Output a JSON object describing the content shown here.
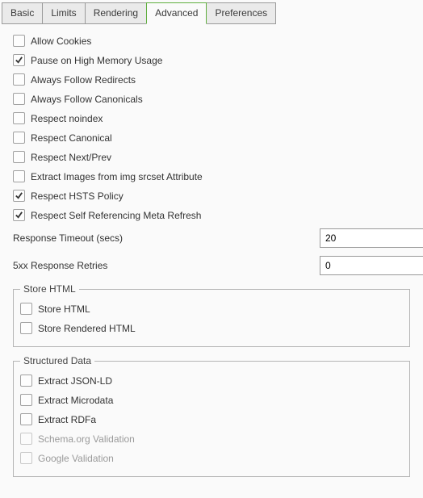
{
  "tabs": [
    {
      "label": "Basic"
    },
    {
      "label": "Limits"
    },
    {
      "label": "Rendering"
    },
    {
      "label": "Advanced"
    },
    {
      "label": "Preferences"
    }
  ],
  "active_tab": "Advanced",
  "checkboxes": [
    {
      "label": "Allow Cookies",
      "checked": false
    },
    {
      "label": "Pause on High Memory Usage",
      "checked": true
    },
    {
      "label": "Always Follow Redirects",
      "checked": false
    },
    {
      "label": "Always Follow Canonicals",
      "checked": false
    },
    {
      "label": "Respect noindex",
      "checked": false
    },
    {
      "label": "Respect Canonical",
      "checked": false
    },
    {
      "label": "Respect Next/Prev",
      "checked": false
    },
    {
      "label": "Extract Images from img srcset Attribute",
      "checked": false
    },
    {
      "label": "Respect HSTS Policy",
      "checked": true
    },
    {
      "label": "Respect Self Referencing Meta Refresh",
      "checked": true
    }
  ],
  "config": {
    "response_timeout_label": "Response Timeout (secs)",
    "response_timeout_value": "20",
    "retries_label": "5xx Response Retries",
    "retries_value": "0"
  },
  "store_html": {
    "legend": "Store HTML",
    "items": [
      {
        "label": "Store HTML",
        "checked": false
      },
      {
        "label": "Store Rendered HTML",
        "checked": false
      }
    ]
  },
  "structured_data": {
    "legend": "Structured Data",
    "items": [
      {
        "label": "Extract JSON-LD",
        "checked": false,
        "disabled": false
      },
      {
        "label": "Extract Microdata",
        "checked": false,
        "disabled": false
      },
      {
        "label": "Extract RDFa",
        "checked": false,
        "disabled": false
      },
      {
        "label": "Schema.org Validation",
        "checked": false,
        "disabled": true
      },
      {
        "label": "Google Validation",
        "checked": false,
        "disabled": true
      }
    ]
  }
}
